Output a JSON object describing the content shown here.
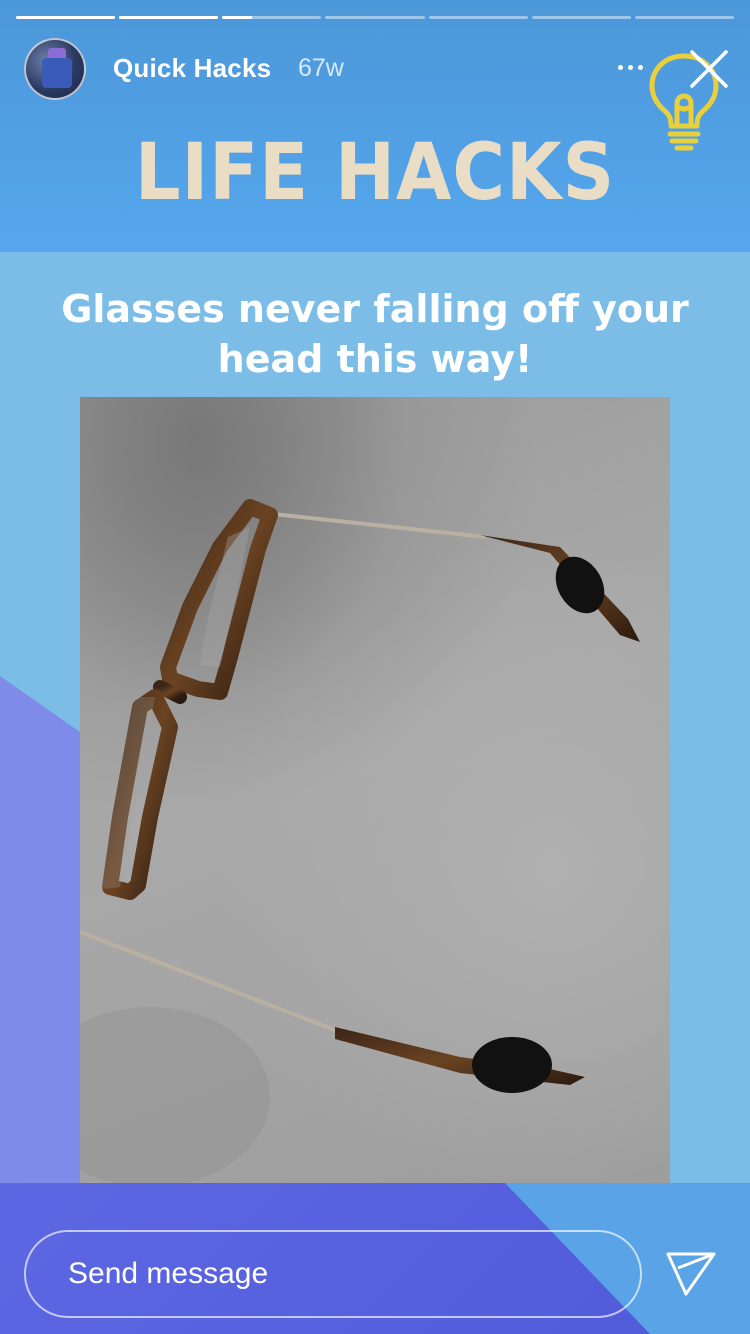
{
  "story": {
    "account_name": "Quick Hacks",
    "post_age": "67w",
    "progress": {
      "segments_total": 7,
      "completed_segments": 2,
      "current_segment_progress": 0.3
    }
  },
  "content": {
    "title": "LIFE HACKS",
    "caption": "Glasses never falling off your head this way!"
  },
  "composer": {
    "placeholder": "Send message"
  },
  "icons": {
    "more": "more-horizontal-icon",
    "close": "close-icon",
    "send": "send-icon",
    "sticker": "lightbulb-icon"
  },
  "colors": {
    "header_blue": "#56a7ee",
    "background_blue": "#7cbde8",
    "purple": "#5d67e2",
    "title_cream": "#eaddc6",
    "bulb_yellow": "#e8cf3c"
  }
}
